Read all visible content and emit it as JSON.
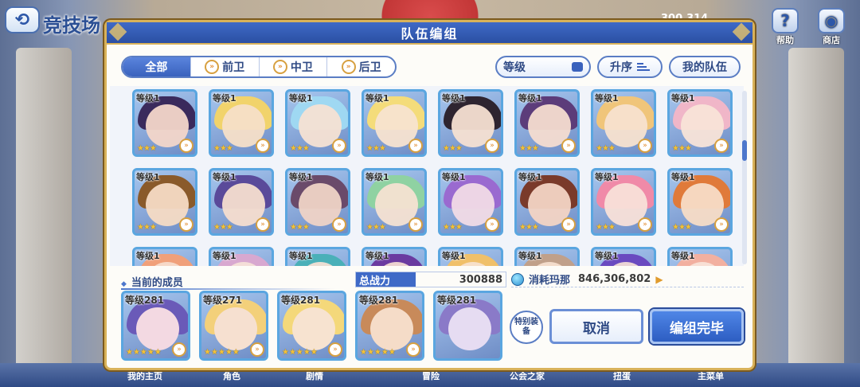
{
  "topbar": {
    "back_icon": "back-arrow-icon",
    "title": "竞技场",
    "score": "300,314",
    "help_label": "帮助",
    "shop_label": "商店"
  },
  "panel": {
    "title": "队伍编组",
    "tabs": [
      {
        "label": "全部",
        "icon": ""
      },
      {
        "label": "前卫",
        "icon": "role-icon"
      },
      {
        "label": "中卫",
        "icon": "role-icon"
      },
      {
        "label": "后卫",
        "icon": "role-icon"
      }
    ],
    "sort_label": "等级",
    "order_label": "升序",
    "my_team_label": "我的队伍"
  },
  "roster": {
    "rows": [
      [
        {
          "level": "等级1",
          "stars": "★★★",
          "colors": [
            "#3a2a5c",
            "#f3d6c9"
          ]
        },
        {
          "level": "等级1",
          "stars": "★★★",
          "colors": [
            "#f1d36b",
            "#f6dfc8"
          ]
        },
        {
          "level": "等级1",
          "stars": "★★★",
          "colors": [
            "#9fd8f2",
            "#f6e2d3"
          ]
        },
        {
          "level": "等级1",
          "stars": "★★★",
          "colors": [
            "#f4dc7a",
            "#f7e3d0"
          ]
        },
        {
          "level": "等级1",
          "stars": "★★★",
          "colors": [
            "#2e2430",
            "#f5e0d2"
          ]
        },
        {
          "level": "等级1",
          "stars": "★★★",
          "colors": [
            "#5c3c7a",
            "#f4dcd0"
          ]
        },
        {
          "level": "等级1",
          "stars": "★★★",
          "colors": [
            "#f0c57a",
            "#f7e1cf"
          ]
        },
        {
          "level": "等级1",
          "stars": "★★★",
          "colors": [
            "#f0b6c8",
            "#f8e4d8"
          ]
        }
      ],
      [
        {
          "level": "等级1",
          "stars": "★★★",
          "colors": [
            "#8a5a2a",
            "#f5dbc4"
          ]
        },
        {
          "level": "等级1",
          "stars": "★★★",
          "colors": [
            "#5a4a9a",
            "#f5ddcf"
          ]
        },
        {
          "level": "等级1",
          "stars": "★★★",
          "colors": [
            "#6a4a6a",
            "#efd3c6"
          ]
        },
        {
          "level": "等级1",
          "stars": "★★★",
          "colors": [
            "#8fd2a2",
            "#f6e2d2"
          ]
        },
        {
          "level": "等级1",
          "stars": "★★★",
          "colors": [
            "#9a6ad0",
            "#f1dbe6"
          ]
        },
        {
          "level": "等级1",
          "stars": "★★★",
          "colors": [
            "#7a3a2a",
            "#f3d4c4"
          ]
        },
        {
          "level": "等级1",
          "stars": "★★★",
          "colors": [
            "#f08aa8",
            "#f8e0d8"
          ]
        },
        {
          "level": "等级1",
          "stars": "★★★",
          "colors": [
            "#e07a3a",
            "#f7dcc6"
          ]
        }
      ],
      [
        {
          "level": "等级1",
          "stars": "★★★",
          "colors": [
            "#f0a07a",
            "#f6dccc"
          ]
        },
        {
          "level": "等级1",
          "stars": "★★★",
          "colors": [
            "#d8a8d0",
            "#f6e0d8"
          ]
        },
        {
          "level": "等级1",
          "stars": "★★★",
          "colors": [
            "#4ab0b8",
            "#f3e0d4"
          ]
        },
        {
          "level": "等级1",
          "stars": "★★★",
          "colors": [
            "#6a3aa0",
            "#f2dad2"
          ]
        },
        {
          "level": "等级1",
          "stars": "★★★",
          "colors": [
            "#f0c06a",
            "#f7e2cf"
          ]
        },
        {
          "level": "等级1",
          "stars": "★★★",
          "colors": [
            "#c0a08a",
            "#f6dfcf"
          ]
        },
        {
          "level": "等级1",
          "stars": "★★★",
          "colors": [
            "#6a4ac0",
            "#f1dbd6"
          ]
        },
        {
          "level": "等级1",
          "stars": "★★★",
          "colors": [
            "#f2b0a0",
            "#f8e3d8"
          ]
        }
      ]
    ]
  },
  "current": {
    "label": "当前的成员",
    "power_label": "总战力",
    "power_value": "300888",
    "mana_label": "消耗玛那",
    "mana_value": "846,306,802",
    "members": [
      {
        "level": "等级281",
        "stars": "★★★★★",
        "colors": [
          "#6a5ab8",
          "#f3d9e2"
        ]
      },
      {
        "level": "等级271",
        "stars": "★★★★★",
        "colors": [
          "#f3d07a",
          "#f6e0d0"
        ]
      },
      {
        "level": "等级281",
        "stars": "★★★★★",
        "colors": [
          "#f4d87a",
          "#f7e3d0"
        ]
      },
      {
        "level": "等级281",
        "stars": "★★★★★",
        "colors": [
          "#c88a5a",
          "#f5dcc8"
        ]
      },
      {
        "level": "等级281",
        "stars": "",
        "colors": [
          "#8a7ac8",
          "#e6dcf2"
        ]
      }
    ],
    "special_label": "特别装备",
    "cancel_label": "取消",
    "done_label": "编组完毕"
  },
  "bottom_nav": [
    "我的主页",
    "角色",
    "剧情",
    "冒险",
    "公会之家",
    "扭蛋",
    "主菜单"
  ]
}
